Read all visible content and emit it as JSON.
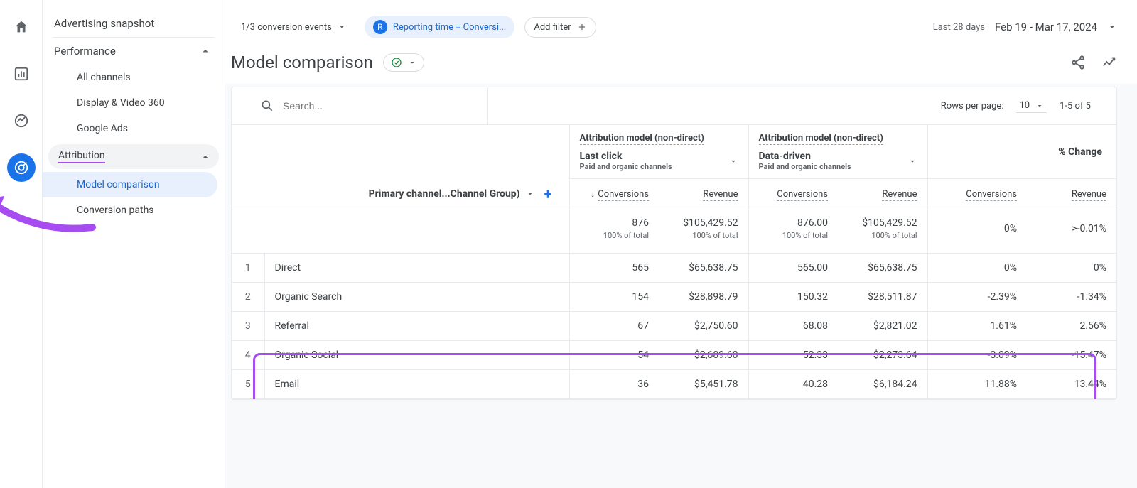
{
  "sidenav": {
    "advertising_snapshot": "Advertising snapshot",
    "performance": "Performance",
    "perf_items": [
      "All channels",
      "Display & Video 360",
      "Google Ads"
    ],
    "attribution": "Attribution",
    "attr_items": [
      "Model comparison",
      "Conversion paths"
    ],
    "attr_selected": "Model comparison"
  },
  "topbar": {
    "conversion_events": "1/3 conversion events",
    "filter_badge": "R",
    "filter_text": "Reporting time = Conversi...",
    "add_filter": "Add filter",
    "date_label": "Last 28 days",
    "date_range": "Feb 19 - Mar 17, 2024"
  },
  "page": {
    "title": "Model comparison"
  },
  "card": {
    "search_placeholder": "Search...",
    "rows_per_page_label": "Rows per page:",
    "rows_per_page_value": "10",
    "page_status": "1-5 of 5",
    "group1_title": "Attribution model (non-direct)",
    "group1_model": "Last click",
    "group1_sub": "Paid and organic channels",
    "group2_title": "Attribution model (non-direct)",
    "group2_model": "Data-driven",
    "group2_sub": "Paid and organic channels",
    "change_title": "% Change",
    "dim_label": "Primary channel...Channel Group)",
    "col_conversions": "Conversions",
    "col_revenue": "Revenue",
    "totals": {
      "g1_conv": "876",
      "g1_conv_sub": "100% of total",
      "g1_rev": "$105,429.52",
      "g1_rev_sub": "100% of total",
      "g2_conv": "876.00",
      "g2_conv_sub": "100% of total",
      "g2_rev": "$105,429.52",
      "g2_rev_sub": "100% of total",
      "chg_conv": "0%",
      "chg_rev": ">-0.01%"
    },
    "rows": [
      {
        "idx": "1",
        "label": "Direct",
        "g1c": "565",
        "g1r": "$65,638.75",
        "g2c": "565.00",
        "g2r": "$65,638.75",
        "cc": "0%",
        "cr": "0%"
      },
      {
        "idx": "2",
        "label": "Organic Search",
        "g1c": "154",
        "g1r": "$28,898.79",
        "g2c": "150.32",
        "g2r": "$28,511.87",
        "cc": "-2.39%",
        "cr": "-1.34%"
      },
      {
        "idx": "3",
        "label": "Referral",
        "g1c": "67",
        "g1r": "$2,750.60",
        "g2c": "68.08",
        "g2r": "$2,821.02",
        "cc": "1.61%",
        "cr": "2.56%"
      },
      {
        "idx": "4",
        "label": "Organic Social",
        "g1c": "54",
        "g1r": "$2,689.60",
        "g2c": "52.33",
        "g2r": "$2,273.64",
        "cc": "-3.09%",
        "cr": "-15.47%"
      },
      {
        "idx": "5",
        "label": "Email",
        "g1c": "36",
        "g1r": "$5,451.78",
        "g2c": "40.28",
        "g2r": "$6,184.24",
        "cc": "11.88%",
        "cr": "13.44%"
      }
    ]
  },
  "colors": {
    "accent": "#1a73e8",
    "annot": "#a64cf0"
  }
}
